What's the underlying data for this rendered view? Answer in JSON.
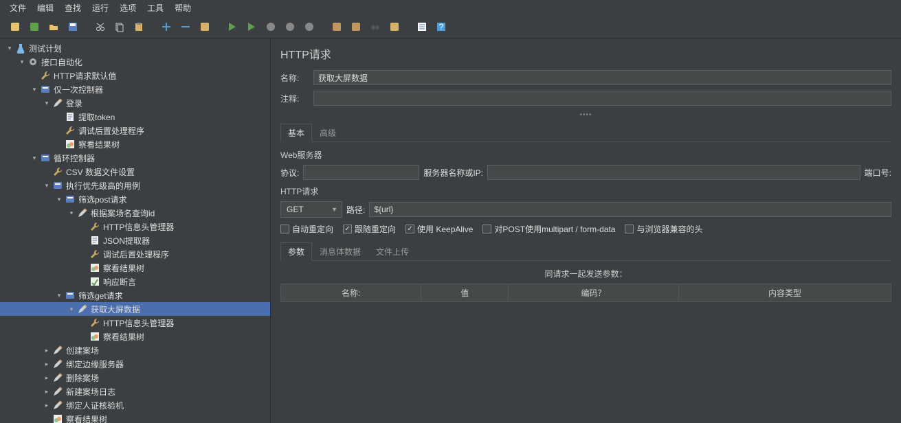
{
  "menu": [
    "文件",
    "编辑",
    "查找",
    "运行",
    "选项",
    "工具",
    "帮助"
  ],
  "toolbar_icons": [
    "new",
    "templates",
    "open",
    "save",
    "",
    "cut",
    "copy",
    "paste",
    "",
    "plus",
    "minus",
    "wrench",
    "",
    "run",
    "run-next",
    "stop",
    "stop-all",
    "shutdown",
    "",
    "broom1",
    "broom2",
    "binoculars",
    "broom3",
    "",
    "list",
    "help"
  ],
  "tree": [
    {
      "d": 0,
      "t": "v",
      "i": "flask",
      "l": "测试计划"
    },
    {
      "d": 1,
      "t": "v",
      "i": "gear",
      "l": "接口自动化"
    },
    {
      "d": 2,
      "t": "",
      "i": "wrench",
      "l": "HTTP请求默认值"
    },
    {
      "d": 2,
      "t": "v",
      "i": "ctrl",
      "l": "仅一次控制器"
    },
    {
      "d": 3,
      "t": "v",
      "i": "pen",
      "l": "登录"
    },
    {
      "d": 4,
      "t": "",
      "i": "doc",
      "l": "提取token"
    },
    {
      "d": 4,
      "t": "",
      "i": "wrench",
      "l": "调试后置处理程序"
    },
    {
      "d": 4,
      "t": "",
      "i": "tree",
      "l": "察看结果树"
    },
    {
      "d": 2,
      "t": "v",
      "i": "ctrl",
      "l": "循环控制器"
    },
    {
      "d": 3,
      "t": "",
      "i": "wrench",
      "l": "CSV 数据文件设置"
    },
    {
      "d": 3,
      "t": "v",
      "i": "ctrl",
      "l": "执行优先级高的用例"
    },
    {
      "d": 4,
      "t": "v",
      "i": "ctrl",
      "l": "筛选post请求"
    },
    {
      "d": 5,
      "t": "v",
      "i": "pen",
      "l": "根据案场名查询id"
    },
    {
      "d": 6,
      "t": "",
      "i": "wrench",
      "l": "HTTP信息头管理器"
    },
    {
      "d": 6,
      "t": "",
      "i": "doc",
      "l": "JSON提取器"
    },
    {
      "d": 6,
      "t": "",
      "i": "wrench",
      "l": "调试后置处理程序"
    },
    {
      "d": 6,
      "t": "",
      "i": "tree",
      "l": "察看结果树"
    },
    {
      "d": 6,
      "t": "",
      "i": "assert",
      "l": "响应断言"
    },
    {
      "d": 4,
      "t": "v",
      "i": "ctrl",
      "l": "筛选get请求"
    },
    {
      "d": 5,
      "t": "v",
      "i": "pen",
      "l": "获取大屏数据",
      "sel": true
    },
    {
      "d": 6,
      "t": "",
      "i": "wrench",
      "l": "HTTP信息头管理器"
    },
    {
      "d": 6,
      "t": "",
      "i": "tree",
      "l": "察看结果树"
    },
    {
      "d": 3,
      "t": ">",
      "i": "pen",
      "l": "创建案场"
    },
    {
      "d": 3,
      "t": ">",
      "i": "pen",
      "l": "绑定边缘服务器"
    },
    {
      "d": 3,
      "t": ">",
      "i": "pen",
      "l": "删除案场"
    },
    {
      "d": 3,
      "t": ">",
      "i": "pen",
      "l": "新建案场日志"
    },
    {
      "d": 3,
      "t": ">",
      "i": "pen",
      "l": "绑定人证核验机"
    },
    {
      "d": 3,
      "t": "",
      "i": "tree",
      "l": "察看结果树"
    }
  ],
  "panel": {
    "title": "HTTP请求",
    "name_label": "名称:",
    "name_value": "获取大屏数据",
    "comment_label": "注释:",
    "comment_value": "",
    "tabs": [
      "基本",
      "高级"
    ],
    "web_server": "Web服务器",
    "protocol_label": "协议:",
    "protocol_value": "",
    "server_label": "服务器名称或IP:",
    "server_value": "",
    "port_label": "端口号:",
    "http_request": "HTTP请求",
    "method": "GET",
    "path_label": "路径:",
    "path_value": "${url}",
    "checks": [
      {
        "label": "自动重定向",
        "checked": false
      },
      {
        "label": "跟随重定向",
        "checked": true
      },
      {
        "label": "使用 KeepAlive",
        "checked": true
      },
      {
        "label": "对POST使用multipart / form-data",
        "checked": false
      },
      {
        "label": "与浏览器兼容的头",
        "checked": false
      }
    ],
    "sub_tabs": [
      "参数",
      "消息体数据",
      "文件上传"
    ],
    "params_title": "同请求一起发送参数：",
    "columns": [
      "名称:",
      "值",
      "编码？",
      "内容类型"
    ]
  }
}
